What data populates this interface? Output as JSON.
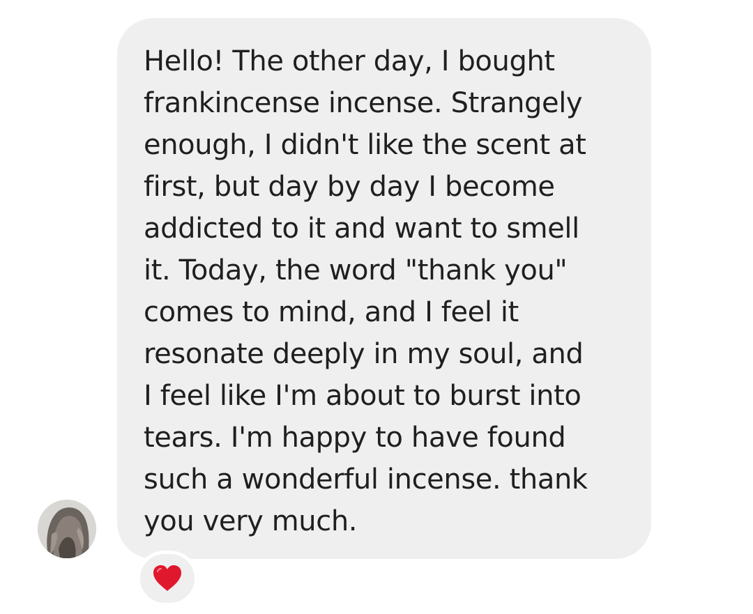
{
  "conversation": {
    "message": {
      "text": "Hello! The other day, I bought\nfrankincense incense. Strangely\nenough, I didn't like the scent at\nfirst, but day by day I become\naddicted to it and want to smell\nit. Today, the word \"thank you\"\ncomes to mind, and I feel it\nresonate deeply in my soul, and\nI feel like I'm about to burst into\ntears. I'm happy to have found\nsuch a wonderful incense. thank\nyou very much.",
      "reaction_icon": "heart-icon",
      "reaction_color": "#e0182d"
    },
    "colors": {
      "bubble_background": "#efefef",
      "text": "#1f1f1f"
    }
  }
}
